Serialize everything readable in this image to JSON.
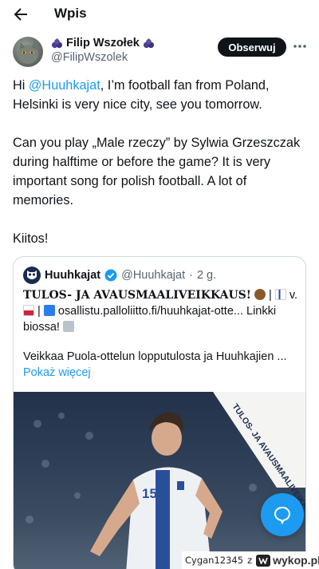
{
  "header": {
    "title": "Wpis"
  },
  "author": {
    "name": "Filip Wszołek",
    "handle": "@FilipWszolek",
    "follow_label": "Obserwuj"
  },
  "tweet": {
    "p1_pre": "Hi ",
    "p1_mention": "@Huuhkajat",
    "p1_post": ", I’m football fan from Poland, Helsinki is very nice city, see you tomorrow.",
    "p2": "Can you play „Male rzeczy” by Sylwia Grzeszczak during halftime or before the game? It is very important song for polish football. A lot of memories.",
    "p3": "Kiitos!"
  },
  "quoted": {
    "name": "Huuhkajat",
    "handle": "@Huuhkajat",
    "separator": "·",
    "time": "2 g.",
    "headline": "TULOS- JA AVAUSMAALIVEIKKAUS!",
    "line_mid": " v. ",
    "link_text": " osallistu.palloliitto.fi/huuhkajat-otte... Linkki biossa! ",
    "para2": "Veikkaa Puola-ottelun lopputulosta ja Huuhkajien ...",
    "show_more": "Pokaż więcej",
    "image_banner": "TULOS- JA AVAUSMAALIVEIKKAUS",
    "shirt_number": "15"
  },
  "watermark": {
    "user": "Cygan12345",
    "z": "z",
    "site": "wykop.pl"
  },
  "colors": {
    "accent": "#1d9bf0",
    "text": "#0f1419",
    "muted": "#536471",
    "border": "#cfd9de"
  }
}
